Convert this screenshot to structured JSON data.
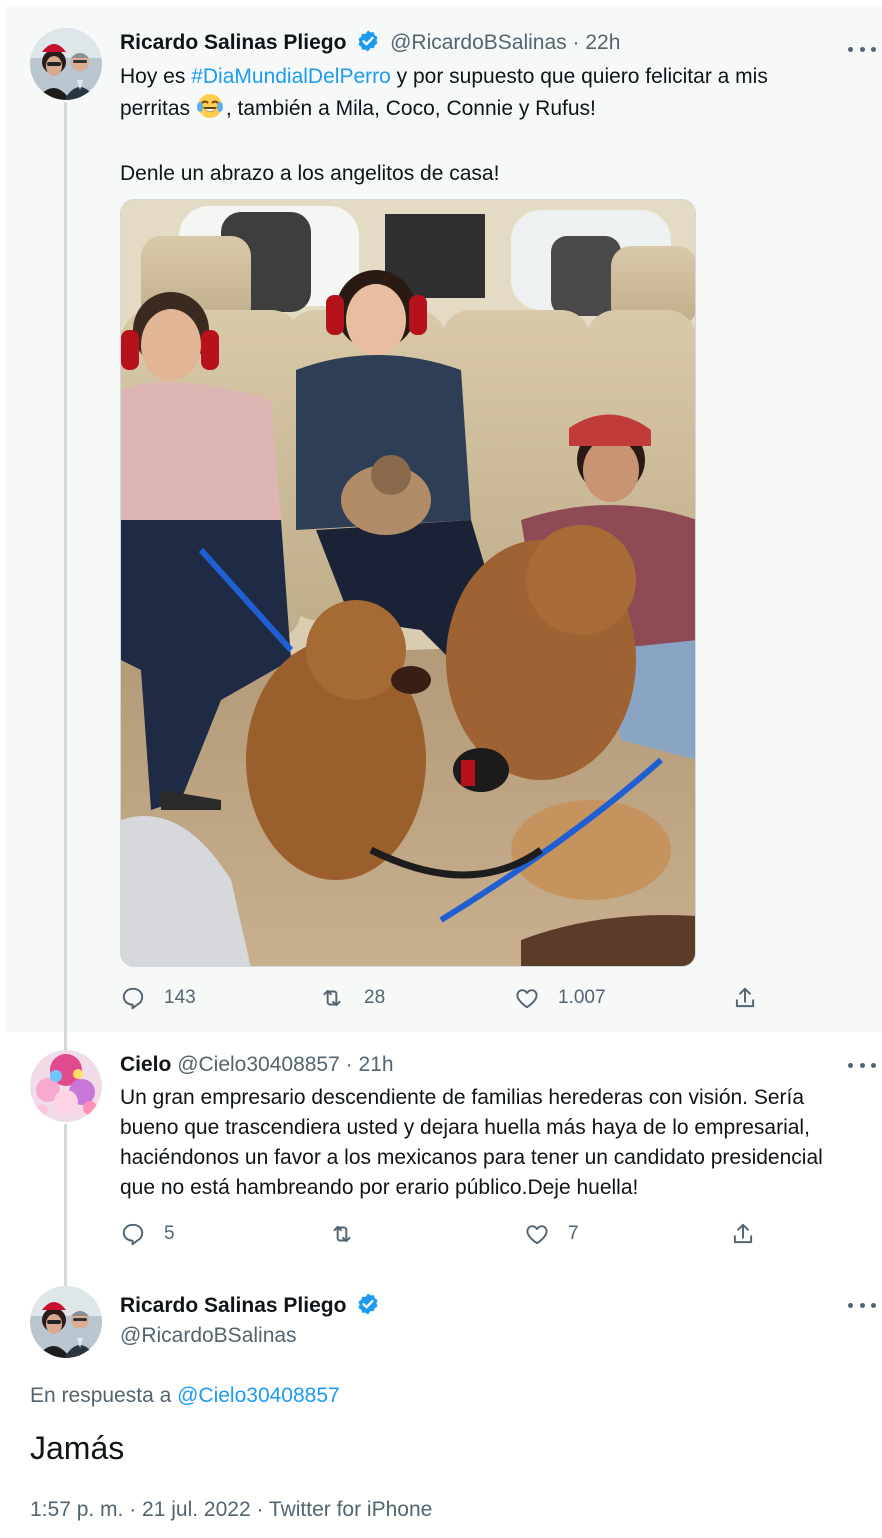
{
  "tweet1": {
    "name": "Ricardo Salinas Pliego",
    "handle": "@RicardoBSalinas",
    "dot": "·",
    "time": "22h",
    "text_before": "Hoy es ",
    "hashtag": "#DiaMundialDelPerro",
    "text_after_hashtag": " y por supuesto que quiero felicitar a mis",
    "line2_before_emoji": "perritas ",
    "emoji_icon": "laughing-crying-emoji",
    "line2_after_emoji": ", también a Mila, Coco, Connie y Rufus!",
    "line3": "Denle un abrazo a los angelitos de casa!",
    "replies": "143",
    "retweets": "28",
    "likes": "1.007"
  },
  "tweet2": {
    "name": "Cielo",
    "handle": "@Cielo30408857",
    "dot": "·",
    "time": "21h",
    "lines": [
      "Un gran empresario descendiente de familias herederas con visión. Sería",
      "bueno que trascendiera usted y dejara huella más haya de lo empresarial,",
      "haciéndonos un favor a los mexicanos para tener un candidato presidencial",
      "que no está hambreando por erario público.Deje huella!"
    ],
    "replies": "5",
    "retweets": "",
    "likes": "7"
  },
  "tweet3": {
    "name": "Ricardo Salinas Pliego",
    "handle": "@RicardoBSalinas",
    "reply_prefix": "En respuesta a ",
    "reply_mention": "@Cielo30408857",
    "text": "Jamás",
    "timestamp": "1:57 p. m. · 21 jul. 2022 · Twitter for iPhone"
  },
  "colors": {
    "accent": "#1d9bf0",
    "text_primary": "#0f1419",
    "text_secondary": "#536471",
    "highlight_bg": "#f7f9f9"
  },
  "icons": [
    "verified-badge-icon",
    "more-options-icon",
    "reply-icon",
    "retweet-icon",
    "like-icon",
    "share-icon"
  ]
}
